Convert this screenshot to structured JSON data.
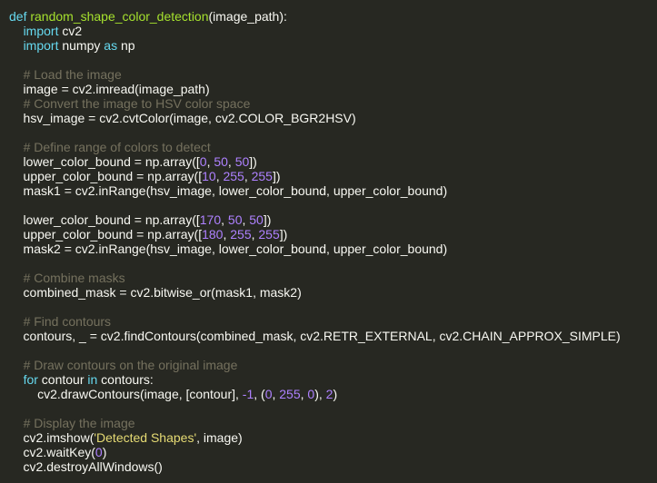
{
  "editor": {
    "theme": {
      "background": "#272822",
      "text": "#f8f8f2",
      "keyword": "#66d9ef",
      "function": "#a6e22e",
      "comment": "#75715e",
      "number": "#ae81ff",
      "string": "#e6db74"
    },
    "lines": [
      [
        {
          "t": "kw",
          "v": "def "
        },
        {
          "t": "fn",
          "v": "random_shape_color_detection"
        },
        {
          "t": "tx",
          "v": "(image_path):"
        }
      ],
      [
        {
          "t": "tx",
          "v": "    "
        },
        {
          "t": "kw",
          "v": "import"
        },
        {
          "t": "tx",
          "v": " cv2"
        }
      ],
      [
        {
          "t": "tx",
          "v": "    "
        },
        {
          "t": "kw",
          "v": "import"
        },
        {
          "t": "tx",
          "v": " numpy "
        },
        {
          "t": "kw",
          "v": "as"
        },
        {
          "t": "tx",
          "v": " np"
        }
      ],
      [],
      [
        {
          "t": "tx",
          "v": "    "
        },
        {
          "t": "cm",
          "v": "# Load the image"
        }
      ],
      [
        {
          "t": "tx",
          "v": "    image "
        },
        {
          "t": "op",
          "v": "="
        },
        {
          "t": "tx",
          "v": " cv2.imread(image_path)"
        }
      ],
      [
        {
          "t": "tx",
          "v": "    "
        },
        {
          "t": "cm",
          "v": "# Convert the image to HSV color space"
        }
      ],
      [
        {
          "t": "tx",
          "v": "    hsv_image "
        },
        {
          "t": "op",
          "v": "="
        },
        {
          "t": "tx",
          "v": " cv2.cvtColor(image, cv2.COLOR_BGR2HSV)"
        }
      ],
      [],
      [
        {
          "t": "tx",
          "v": "    "
        },
        {
          "t": "cm",
          "v": "# Define range of colors to detect"
        }
      ],
      [
        {
          "t": "tx",
          "v": "    lower_color_bound "
        },
        {
          "t": "op",
          "v": "="
        },
        {
          "t": "tx",
          "v": " np.array(["
        },
        {
          "t": "nm",
          "v": "0"
        },
        {
          "t": "tx",
          "v": ", "
        },
        {
          "t": "nm",
          "v": "50"
        },
        {
          "t": "tx",
          "v": ", "
        },
        {
          "t": "nm",
          "v": "50"
        },
        {
          "t": "tx",
          "v": "])"
        }
      ],
      [
        {
          "t": "tx",
          "v": "    upper_color_bound "
        },
        {
          "t": "op",
          "v": "="
        },
        {
          "t": "tx",
          "v": " np.array(["
        },
        {
          "t": "nm",
          "v": "10"
        },
        {
          "t": "tx",
          "v": ", "
        },
        {
          "t": "nm",
          "v": "255"
        },
        {
          "t": "tx",
          "v": ", "
        },
        {
          "t": "nm",
          "v": "255"
        },
        {
          "t": "tx",
          "v": "])"
        }
      ],
      [
        {
          "t": "tx",
          "v": "    mask1 "
        },
        {
          "t": "op",
          "v": "="
        },
        {
          "t": "tx",
          "v": " cv2.inRange(hsv_image, lower_color_bound, upper_color_bound)"
        }
      ],
      [],
      [
        {
          "t": "tx",
          "v": "    lower_color_bound "
        },
        {
          "t": "op",
          "v": "="
        },
        {
          "t": "tx",
          "v": " np.array(["
        },
        {
          "t": "nm",
          "v": "170"
        },
        {
          "t": "tx",
          "v": ", "
        },
        {
          "t": "nm",
          "v": "50"
        },
        {
          "t": "tx",
          "v": ", "
        },
        {
          "t": "nm",
          "v": "50"
        },
        {
          "t": "tx",
          "v": "])"
        }
      ],
      [
        {
          "t": "tx",
          "v": "    upper_color_bound "
        },
        {
          "t": "op",
          "v": "="
        },
        {
          "t": "tx",
          "v": " np.array(["
        },
        {
          "t": "nm",
          "v": "180"
        },
        {
          "t": "tx",
          "v": ", "
        },
        {
          "t": "nm",
          "v": "255"
        },
        {
          "t": "tx",
          "v": ", "
        },
        {
          "t": "nm",
          "v": "255"
        },
        {
          "t": "tx",
          "v": "])"
        }
      ],
      [
        {
          "t": "tx",
          "v": "    mask2 "
        },
        {
          "t": "op",
          "v": "="
        },
        {
          "t": "tx",
          "v": " cv2.inRange(hsv_image, lower_color_bound, upper_color_bound)"
        }
      ],
      [],
      [
        {
          "t": "tx",
          "v": "    "
        },
        {
          "t": "cm",
          "v": "# Combine masks"
        }
      ],
      [
        {
          "t": "tx",
          "v": "    combined_mask "
        },
        {
          "t": "op",
          "v": "="
        },
        {
          "t": "tx",
          "v": " cv2.bitwise_or(mask1, mask2)"
        }
      ],
      [],
      [
        {
          "t": "tx",
          "v": "    "
        },
        {
          "t": "cm",
          "v": "# Find contours"
        }
      ],
      [
        {
          "t": "tx",
          "v": "    contours, _ "
        },
        {
          "t": "op",
          "v": "="
        },
        {
          "t": "tx",
          "v": " cv2.findContours(combined_mask, cv2.RETR_EXTERNAL, cv2.CHAIN_APPROX_SIMPLE)"
        }
      ],
      [],
      [
        {
          "t": "tx",
          "v": "    "
        },
        {
          "t": "cm",
          "v": "# Draw contours on the original image"
        }
      ],
      [
        {
          "t": "tx",
          "v": "    "
        },
        {
          "t": "kw",
          "v": "for"
        },
        {
          "t": "tx",
          "v": " contour "
        },
        {
          "t": "kw",
          "v": "in"
        },
        {
          "t": "tx",
          "v": " contours:"
        }
      ],
      [
        {
          "t": "tx",
          "v": "        cv2.drawContours(image, [contour], "
        },
        {
          "t": "nm",
          "v": "-1"
        },
        {
          "t": "tx",
          "v": ", ("
        },
        {
          "t": "nm",
          "v": "0"
        },
        {
          "t": "tx",
          "v": ", "
        },
        {
          "t": "nm",
          "v": "255"
        },
        {
          "t": "tx",
          "v": ", "
        },
        {
          "t": "nm",
          "v": "0"
        },
        {
          "t": "tx",
          "v": "), "
        },
        {
          "t": "nm",
          "v": "2"
        },
        {
          "t": "tx",
          "v": ")"
        }
      ],
      [],
      [
        {
          "t": "tx",
          "v": "    "
        },
        {
          "t": "cm",
          "v": "# Display the image"
        }
      ],
      [
        {
          "t": "tx",
          "v": "    cv2.imshow("
        },
        {
          "t": "st",
          "v": "'Detected Shapes'"
        },
        {
          "t": "tx",
          "v": ", image)"
        }
      ],
      [
        {
          "t": "tx",
          "v": "    cv2.waitKey("
        },
        {
          "t": "nm",
          "v": "0"
        },
        {
          "t": "tx",
          "v": ")"
        }
      ],
      [
        {
          "t": "tx",
          "v": "    cv2.destroyAllWindows()"
        }
      ]
    ]
  }
}
